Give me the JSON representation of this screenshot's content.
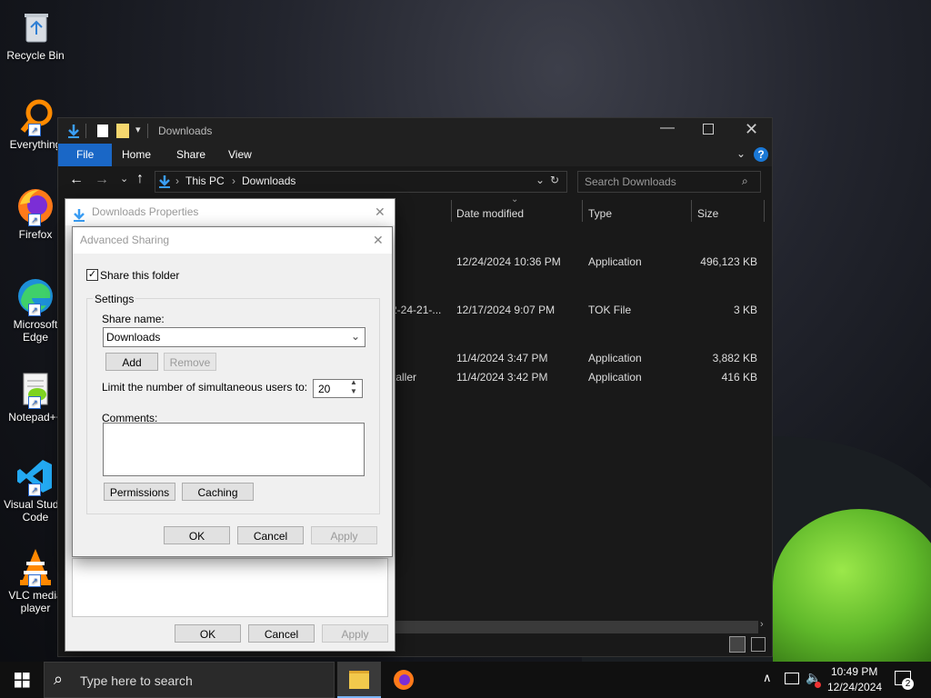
{
  "desktop": {
    "icons": [
      {
        "label": "Recycle Bin"
      },
      {
        "label": "Everything"
      },
      {
        "label": "Firefox"
      },
      {
        "label": "Microsoft Edge"
      },
      {
        "label": "Notepad++"
      },
      {
        "label": "Visual Studio Code"
      },
      {
        "label": "VLC media player"
      }
    ]
  },
  "explorer": {
    "title": "Downloads",
    "ribbon_tabs": [
      "File",
      "Home",
      "Share",
      "View"
    ],
    "breadcrumb": [
      "This PC",
      "Downloads"
    ],
    "search_placeholder": "Search Downloads",
    "columns": [
      "Date modified",
      "Type",
      "Size"
    ],
    "rows": [
      {
        "name": "",
        "date": "12/24/2024 10:36 PM",
        "type": "Application",
        "size": "496,123 KB"
      },
      {
        "name": "2-24-21-...",
        "date": "12/17/2024 9:07 PM",
        "type": "TOK File",
        "size": "3 KB"
      },
      {
        "name": "",
        "date": "11/4/2024 3:47 PM",
        "type": "Application",
        "size": "3,882 KB"
      },
      {
        "name": "taller",
        "date": "11/4/2024 3:42 PM",
        "type": "Application",
        "size": "416 KB"
      }
    ]
  },
  "properties": {
    "title": "Downloads Properties",
    "ok": "OK",
    "cancel": "Cancel",
    "apply": "Apply"
  },
  "sharing": {
    "title": "Advanced Sharing",
    "share_checkbox": "Share this folder",
    "settings_label": "Settings",
    "share_name_label": "Share name:",
    "share_name_value": "Downloads",
    "add": "Add",
    "remove": "Remove",
    "limit_label": "Limit the number of simultaneous users to:",
    "limit_value": "20",
    "comments_label": "Comments:",
    "permissions": "Permissions",
    "caching": "Caching",
    "ok": "OK",
    "cancel": "Cancel",
    "apply": "Apply"
  },
  "taskbar": {
    "search_placeholder": "Type here to search",
    "time": "10:49 PM",
    "date": "12/24/2024",
    "notifications": "2"
  }
}
